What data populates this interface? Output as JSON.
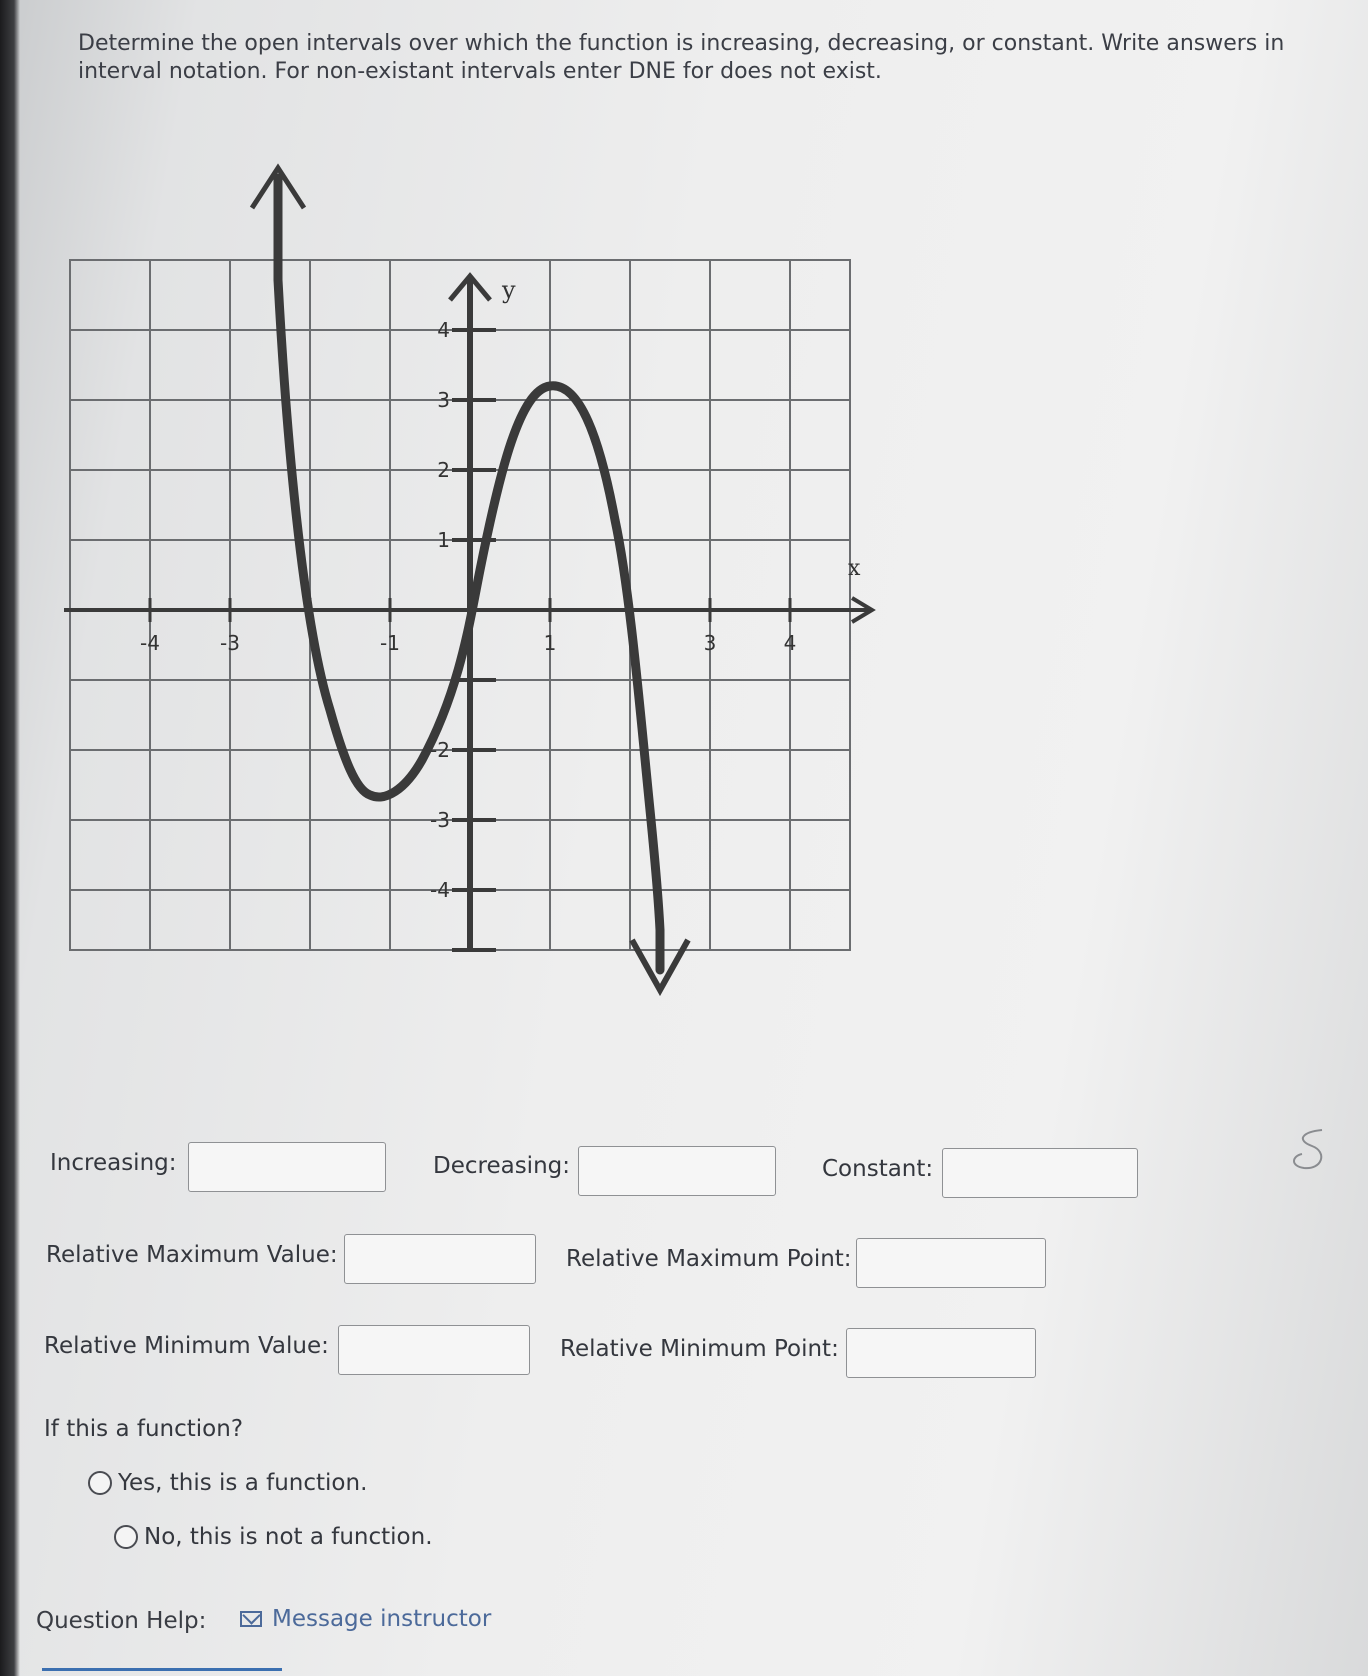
{
  "instructions": "Determine the open intervals over which the function is increasing, decreasing, or constant. Write answers in interval notation. For non-existant intervals enter DNE for does not exist.",
  "graph": {
    "x_axis_label": "x",
    "y_axis_label": "y",
    "x_tick_labels": [
      "-4",
      "-3",
      "-1",
      "1",
      "3",
      "4"
    ],
    "y_tick_labels": [
      "4",
      "3",
      "2",
      "1",
      "-2",
      "-3",
      "-4"
    ],
    "curve_color": "#3a3a3a",
    "grid_color": "#6b6d70"
  },
  "fields": {
    "increasing_label": "Increasing:",
    "decreasing_label": "Decreasing:",
    "constant_label": "Constant:",
    "rel_max_value_label": "Relative Maximum Value:",
    "rel_max_point_label": "Relative Maximum Point:",
    "rel_min_value_label": "Relative Minimum Value:",
    "rel_min_point_label": "Relative Minimum Point:",
    "increasing_value": "",
    "decreasing_value": "",
    "constant_value": "",
    "rel_max_value": "",
    "rel_max_point": "",
    "rel_min_value": "",
    "rel_min_point": ""
  },
  "function_question": {
    "prompt": "If this a function?",
    "options": [
      "Yes, this is a function.",
      "No, this is not a function."
    ]
  },
  "help": {
    "label": "Question Help:",
    "link_text": "Message instructor"
  }
}
